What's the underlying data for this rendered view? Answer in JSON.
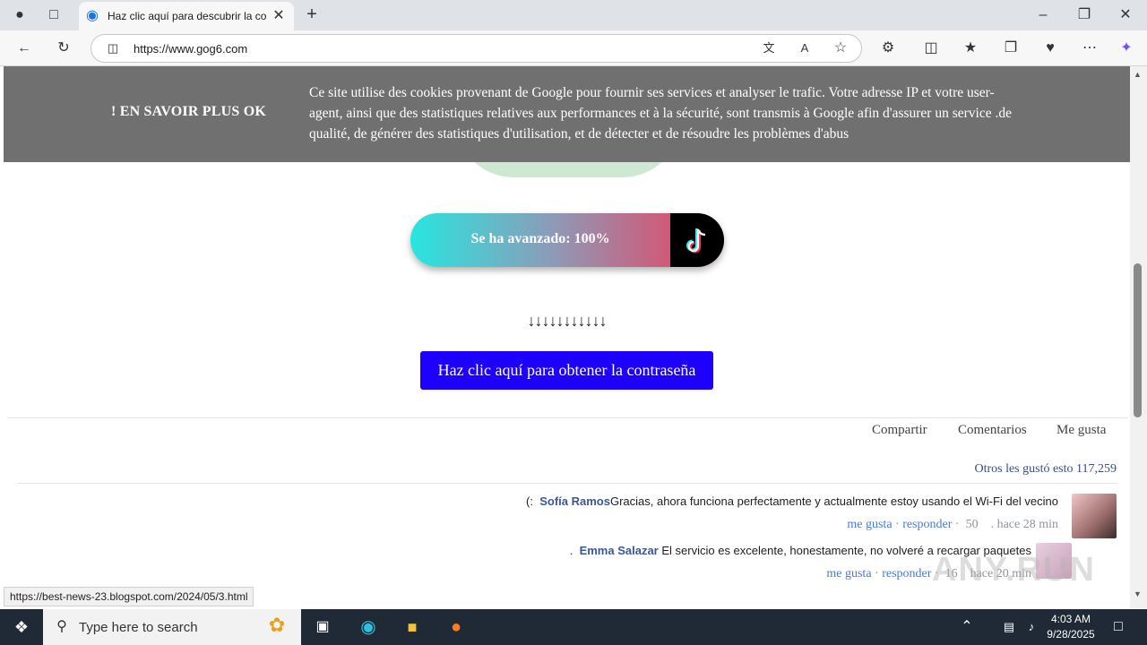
{
  "browser": {
    "tab_title": "Haz clic aquí para descubrir la co",
    "url": "https://www.gog6.com",
    "status_url": "https://best-news-23.blogspot.com/2024/05/3.html"
  },
  "cookie_banner": {
    "actions": "!   EN SAVOIR PLUS  OK",
    "text": "Ce site utilise des cookies provenant de Google pour fournir ses services et analyser le trafic. Votre adresse IP et votre user-agent, ainsi que des statistiques relatives aux performances et à la sécurité, sont transmis à Google afin d'assurer un service .de qualité, de générer des statistiques d'utilisation, et de détecter et de résoudre les problèmes d'abus"
  },
  "progress": {
    "label": "Se ha avanzado: 100%",
    "value": 1.0
  },
  "arrows": "↓↓↓↓↓↓↓↓↓↓↓",
  "cta_label": "Haz clic aquí para obtener la contraseña",
  "social": {
    "share": "Compartir",
    "comments": "Comentarios",
    "like": "Me gusta"
  },
  "likes_summary": "Otros les gustó esto 117,259",
  "comments": [
    {
      "prefix": "(:",
      "author": "Sofía Ramos",
      "text": "Gracias, ahora funciona perfectamente y actualmente estoy usando el Wi-Fi del vecino",
      "like": "me gusta",
      "reply": "responder",
      "count": "50",
      "time": ". hace 28 min"
    },
    {
      "prefix": ".",
      "author": "Emma Salazar",
      "text": " El servicio es excelente, honestamente, no volveré a recargar paquetes",
      "like": "me gusta",
      "reply": "responder",
      "count": "16",
      "time": "hace 20 min"
    }
  ],
  "taskbar": {
    "search_placeholder": "Type here to search",
    "time": "4:03 AM",
    "date": "9/28/2025"
  },
  "watermark": "ANY.RUN"
}
